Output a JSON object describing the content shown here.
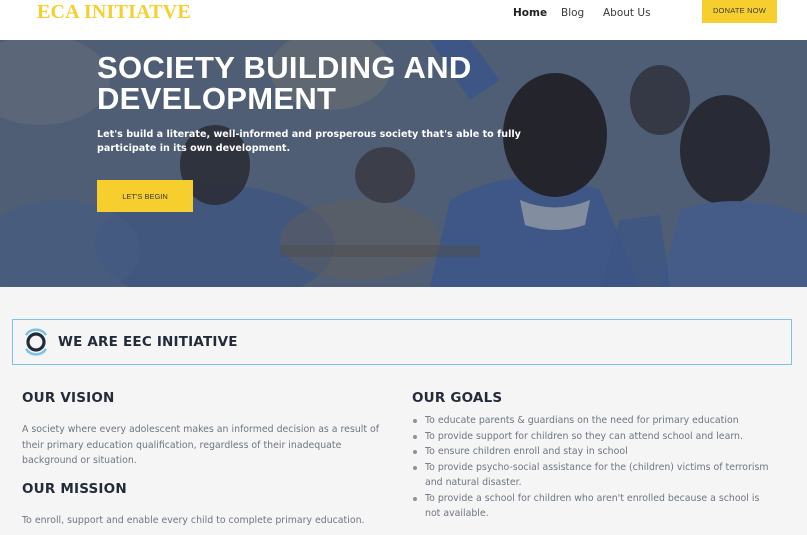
{
  "header": {
    "brand": "ECA INITIATVE",
    "nav": {
      "home": "Home",
      "blog": "Blog",
      "about": "About Us"
    },
    "donate_label": "DONATE NOW"
  },
  "hero": {
    "title": "SOCIETY BUILDING AND DEVELOPMENT",
    "subtitle": "Let's build a literate, well-informed and prosperous society that's able to fully participate in its own development.",
    "cta_label": "LET'S BEGIN"
  },
  "about": {
    "title": "WE ARE EEC INITIATIVE"
  },
  "vision": {
    "title": "OUR VISION",
    "text": "A society where every adolescent makes an informed decision as a result of their primary education qualification, regardless of their inadequate background or situation."
  },
  "mission": {
    "title": "OUR MISSION",
    "text": "To enroll, support and enable every child to complete primary education."
  },
  "goals": {
    "title": "OUR GOALS",
    "items": [
      "To educate parents & guardians on the need for primary education",
      "To provide support for children so they can attend school and learn.",
      "To ensure children enroll and stay in school",
      "To provide psycho-social assistance for the (children) victims of terrorism and natural disaster.",
      "To provide a school for children who aren't enrolled because a school is not available."
    ]
  },
  "colors": {
    "accent_yellow": "#f6cf2f",
    "box_border": "#7dc4e4",
    "heading": "#232b38",
    "body_text": "#6e7682"
  }
}
